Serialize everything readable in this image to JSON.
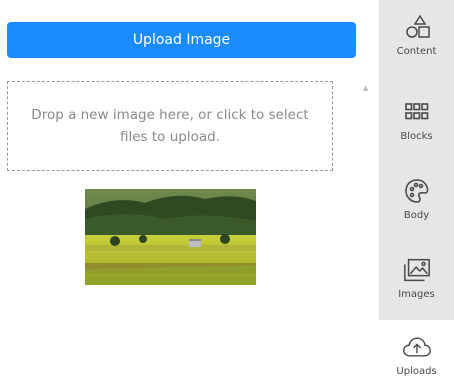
{
  "colors": {
    "accent": "#1a8cff",
    "sidebar_bg": "#e6e6e6",
    "active_tab_bg": "#ffffff",
    "text": "#4a4a4a"
  },
  "upload": {
    "button_label": "Upload Image",
    "dropzone_text": "Drop a new image here, or click to select files to upload."
  },
  "sidebar": {
    "tabs": [
      {
        "label": "Content",
        "icon": "shapes-icon"
      },
      {
        "label": "Blocks",
        "icon": "grid-icon"
      },
      {
        "label": "Body",
        "icon": "palette-icon"
      },
      {
        "label": "Images",
        "icon": "image-icon"
      },
      {
        "label": "Uploads",
        "icon": "cloud-upload-icon",
        "active": true
      }
    ]
  }
}
